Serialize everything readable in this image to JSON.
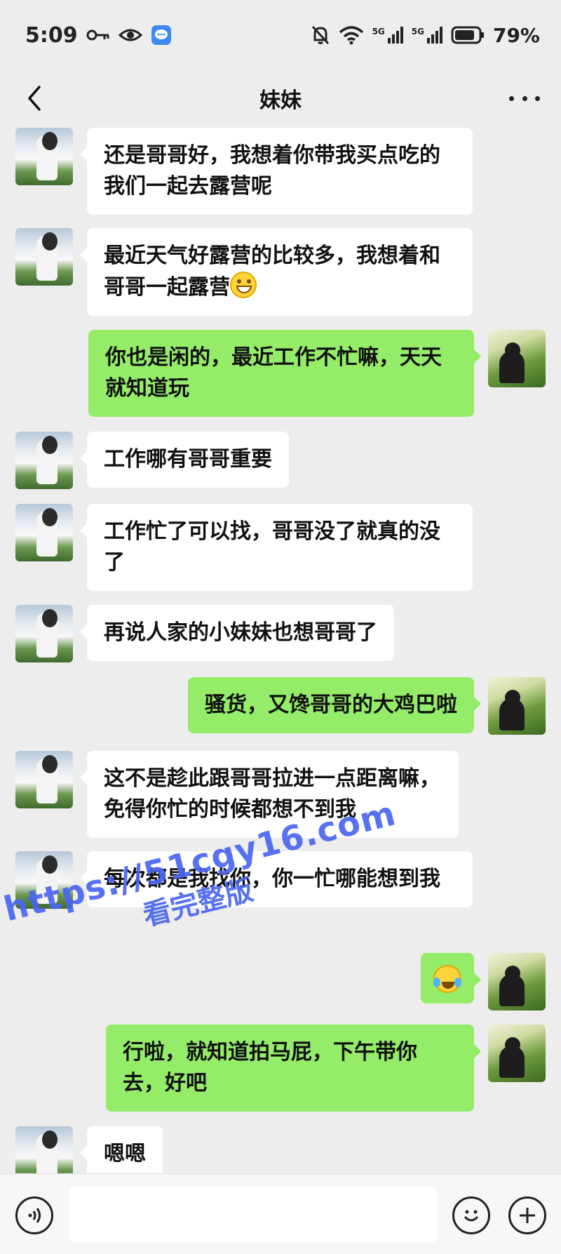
{
  "status_bar": {
    "time": "5:09",
    "battery": "79%",
    "icons": [
      "key-icon",
      "eye-icon",
      "message-app-icon",
      "mute-icon",
      "wifi-icon",
      "5g-signal-icon",
      "5g-signal-icon",
      "battery-icon"
    ],
    "network_label": "5G"
  },
  "nav": {
    "title": "妹妹"
  },
  "messages": [
    {
      "side": "left",
      "text": "还是哥哥好，我想着你带我买点吃的我们一起去露营呢"
    },
    {
      "side": "left",
      "text": "最近天气好露营的比较多，我想着和哥哥一起露营",
      "emoji": "grin-emoji-icon"
    },
    {
      "side": "right",
      "text": "你也是闲的，最近工作不忙嘛，天天就知道玩"
    },
    {
      "side": "left",
      "text": "工作哪有哥哥重要"
    },
    {
      "side": "left",
      "text": "工作忙了可以找，哥哥没了就真的没了"
    },
    {
      "side": "left",
      "text": "再说人家的小妹妹也想哥哥了"
    },
    {
      "side": "right",
      "text": "骚货，又馋哥哥的大鸡巴啦"
    },
    {
      "side": "left",
      "text": "这不是趁此跟哥哥拉进一点距离嘛，免得你忙的时候都想不到我"
    },
    {
      "side": "left",
      "text": "每次都是我找你，你一忙哪能想到我"
    },
    {
      "side": "right",
      "text": "",
      "emoji": "laugh-cry-emoji-icon"
    },
    {
      "side": "right",
      "text": "行啦，就知道拍马屁，下午带你去，好吧"
    },
    {
      "side": "left",
      "text": "嗯嗯"
    }
  ],
  "watermark": {
    "url": "https://51cgy16.com",
    "subtitle": "看完整版"
  },
  "input": {
    "value": "",
    "placeholder": ""
  },
  "colors": {
    "background": "#ededed",
    "received_bubble": "#ffffff",
    "sent_bubble": "#95ec69",
    "watermark": "#4a66f0"
  }
}
